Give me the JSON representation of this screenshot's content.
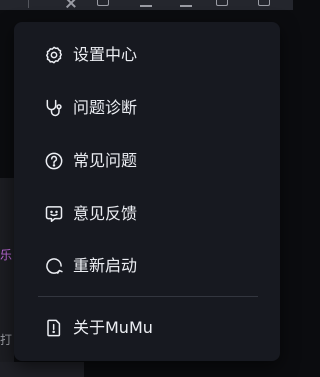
{
  "backdrop": {
    "music_snippet": "乐",
    "play_snippet": "打"
  },
  "menu": {
    "items": [
      {
        "label": "设置中心",
        "icon": "gear-icon"
      },
      {
        "label": "问题诊断",
        "icon": "stethoscope-icon"
      },
      {
        "label": "常见问题",
        "icon": "question-circle-icon"
      },
      {
        "label": "意见反馈",
        "icon": "feedback-bubble-icon"
      },
      {
        "label": "重新启动",
        "icon": "restart-icon"
      },
      {
        "label": "关于MuMu",
        "icon": "info-document-icon"
      }
    ]
  },
  "colors": {
    "menu_background": "#171920",
    "text": "#eceef3",
    "divider": "#33363f",
    "accent_purple": "#c06bdc"
  }
}
